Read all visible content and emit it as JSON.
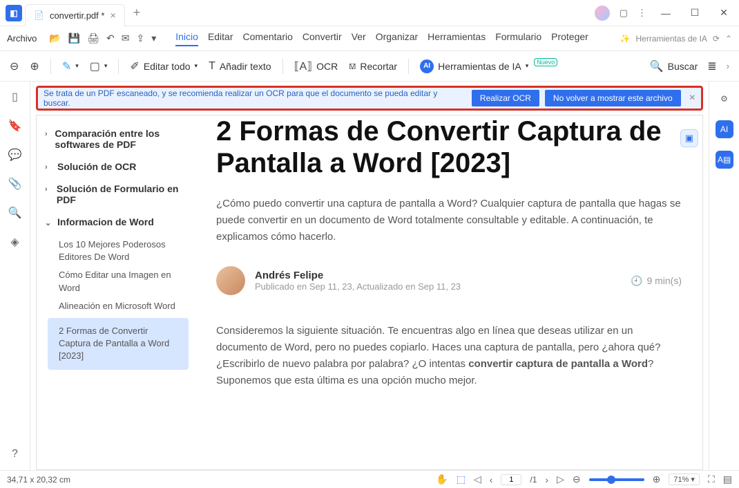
{
  "tab": {
    "title": "convertir.pdf *"
  },
  "menubar": {
    "file": "Archivo",
    "items": [
      "Inicio",
      "Editar",
      "Comentario",
      "Convertir",
      "Ver",
      "Organizar",
      "Herramientas",
      "Formulario",
      "Proteger"
    ],
    "ai_right": "Herramientas de IA"
  },
  "toolbar": {
    "editar_todo": "Editar todo",
    "anadir_texto": "Añadir texto",
    "ocr": "OCR",
    "recortar": "Recortar",
    "herramientas_ia": "Herramientas de IA",
    "nuevo": "Nuevo",
    "buscar": "Buscar"
  },
  "banner": {
    "text": "Se trata de un PDF escaneado, y se recomienda realizar un OCR para que el documento se pueda editar y buscar.",
    "realizar": "Realizar OCR",
    "novolver": "No volver a mostrar este archivo"
  },
  "outline": {
    "items": [
      {
        "label": "Comparación entre los softwares de PDF",
        "expanded": false
      },
      {
        "label": "Solución de OCR",
        "expanded": false
      },
      {
        "label": "Solución de Formulario en PDF",
        "expanded": false
      },
      {
        "label": "Informacion de Word",
        "expanded": true
      }
    ],
    "subs": [
      "Los 10 Mejores Poderosos Editores De Word",
      "Cómo Editar una Imagen en Word",
      "Alineación en Microsoft Word",
      "2 Formas de Convertir Captura de Pantalla a Word [2023]"
    ]
  },
  "doc": {
    "title": "2 Formas de Convertir Captura de Pantalla a Word [2023]",
    "intro": "¿Cómo puedo convertir una captura de pantalla a Word? Cualquier captura de pantalla que hagas se puede convertir en un documento de Word totalmente consultable y editable. A continuación, te explicamos cómo hacerlo.",
    "author": "Andrés Felipe",
    "author_meta": "Publicado en Sep 11, 23, Actualizado en Sep 11, 23",
    "read_time": "9 min(s)",
    "body1": "Consideremos la siguiente situación. Te encuentras algo en línea que deseas utilizar en un documento de Word, pero no puedes copiarlo. Haces una captura de pantalla, pero ¿ahora qué? ¿Escribirlo de nuevo palabra por palabra? ¿O intentas ",
    "body1_bold": "convertir captura de pantalla a Word",
    "body1_tail": "? Suponemos que esta última es una opción mucho mejor."
  },
  "status": {
    "dims": "34,71 x 20,32 cm",
    "page_current": "1",
    "page_total": "/1",
    "zoom": "71%"
  }
}
